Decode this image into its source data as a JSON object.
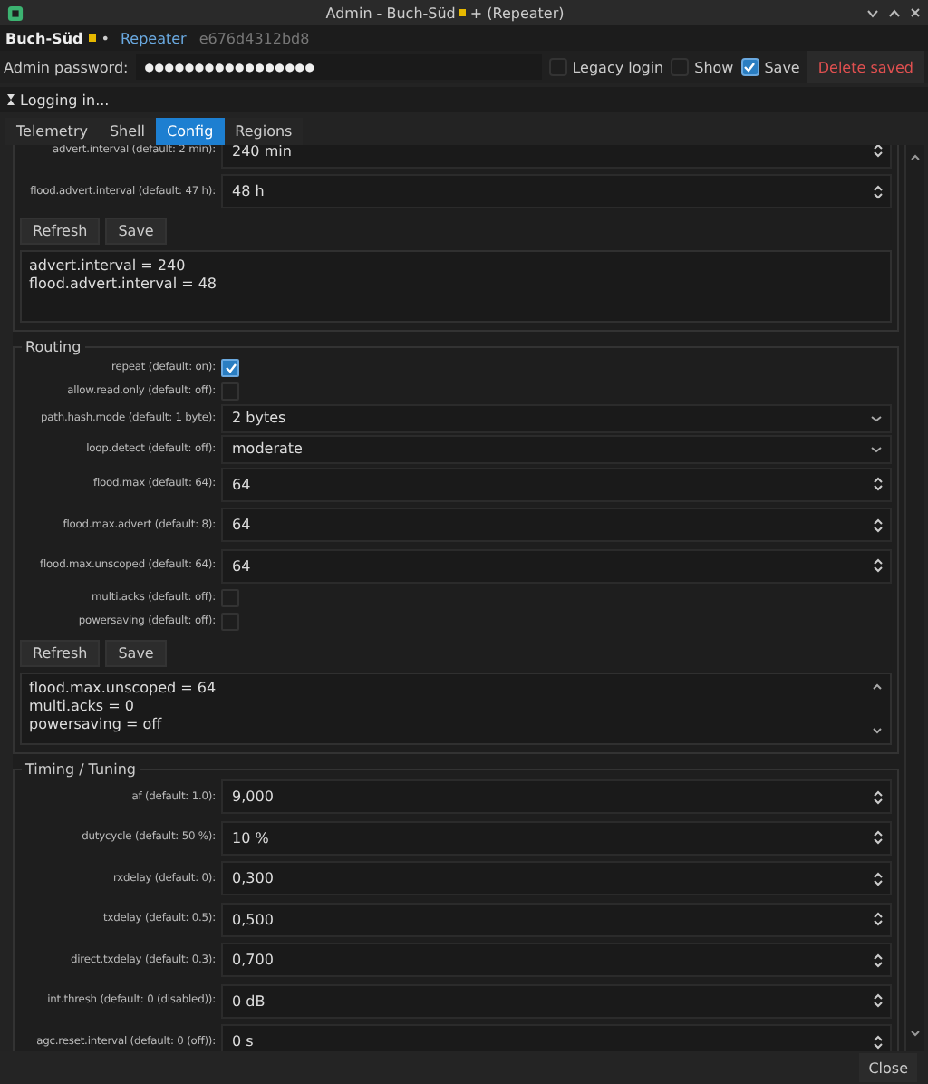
{
  "window": {
    "title": "Admin - Buch-Süd",
    "title_suffix": "+ (Repeater)"
  },
  "node": {
    "name": "Buch-Süd",
    "mark": "•",
    "type": "Repeater",
    "id": "e676d4312bd8"
  },
  "login": {
    "label": "Admin password:",
    "value": "●●●●●●●●●●●●●●●●●",
    "legacy_login": {
      "label": "Legacy login",
      "checked": false
    },
    "show": {
      "label": "Show",
      "checked": false
    },
    "save": {
      "label": "Save",
      "checked": true
    },
    "delete_label": "Delete saved"
  },
  "status": "Logging in...",
  "tabs": [
    {
      "label": "Telemetry",
      "selected": false
    },
    {
      "label": "Shell",
      "selected": false
    },
    {
      "label": "Config",
      "selected": true
    },
    {
      "label": "Regions",
      "selected": false
    }
  ],
  "groups": [
    {
      "fields": [
        {
          "kind": "spin",
          "label": "advert.interval (default: 2 min):",
          "value": "240 min"
        },
        {
          "kind": "spin",
          "label": "flood.advert.interval (default: 47 h):",
          "value": "48 h"
        }
      ],
      "buttons": [
        "Refresh",
        "Save"
      ],
      "output": [
        "advert.interval = 240",
        "flood.advert.interval = 48"
      ]
    },
    {
      "title": "Routing",
      "fields": [
        {
          "kind": "check",
          "label": "repeat (default: on):",
          "checked": true
        },
        {
          "kind": "check",
          "label": "allow.read.only (default: off):",
          "checked": false
        },
        {
          "kind": "combo",
          "label": "path.hash.mode (default: 1 byte):",
          "value": "2 bytes"
        },
        {
          "kind": "combo",
          "label": "loop.detect (default: off):",
          "value": "moderate"
        },
        {
          "kind": "spin",
          "label": "flood.max (default: 64):",
          "value": "64"
        },
        {
          "kind": "spin",
          "label": "flood.max.advert (default: 8):",
          "value": "64"
        },
        {
          "kind": "spin",
          "label": "flood.max.unscoped (default: 64):",
          "value": "64"
        },
        {
          "kind": "check",
          "label": "multi.acks (default: off):",
          "checked": false
        },
        {
          "kind": "check",
          "label": "powersaving (default: off):",
          "checked": false
        }
      ],
      "buttons": [
        "Refresh",
        "Save"
      ],
      "output": [
        "flood.max.unscoped = 64",
        "multi.acks = 0",
        "powersaving = off"
      ]
    },
    {
      "title": "Timing / Tuning",
      "fields": [
        {
          "kind": "spin",
          "label": "af (default: 1.0):",
          "value": "9,000"
        },
        {
          "kind": "spin",
          "label": "dutycycle (default: 50 %):",
          "value": "10 %"
        },
        {
          "kind": "spin",
          "label": "rxdelay (default: 0):",
          "value": "0,300"
        },
        {
          "kind": "spin",
          "label": "txdelay (default: 0.5):",
          "value": "0,500"
        },
        {
          "kind": "spin",
          "label": "direct.txdelay (default: 0.3):",
          "value": "0,700"
        },
        {
          "kind": "spin",
          "label": "int.thresh (default: 0 (disabled)):",
          "value": "0 dB"
        },
        {
          "kind": "spin",
          "label": "agc.reset.interval (default: 0 (off)):",
          "value": "0 s"
        }
      ]
    }
  ],
  "close_label": "Close"
}
